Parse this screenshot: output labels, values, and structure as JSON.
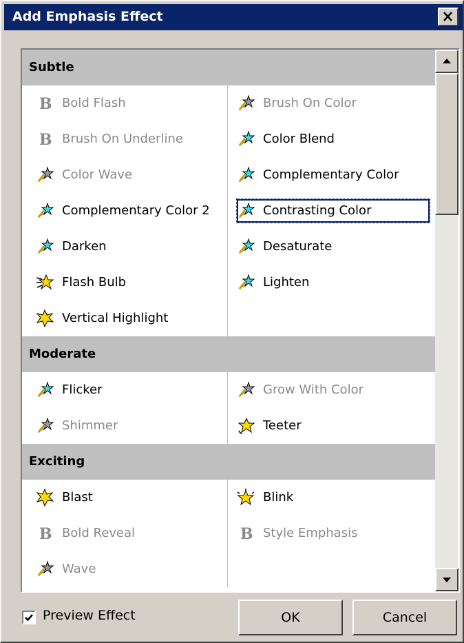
{
  "window": {
    "title": "Add Emphasis Effect"
  },
  "categories": [
    {
      "name": "Subtle",
      "items": [
        {
          "label": "Bold Flash",
          "icon": "bold-icon",
          "enabled": false,
          "col": 0,
          "row": 0
        },
        {
          "label": "Brush On Color",
          "icon": "star-effect-icon",
          "enabled": false,
          "col": 1,
          "row": 0
        },
        {
          "label": "Brush On Underline",
          "icon": "bold-icon",
          "enabled": false,
          "col": 0,
          "row": 1
        },
        {
          "label": "Color Blend",
          "icon": "star-effect-icon",
          "enabled": true,
          "col": 1,
          "row": 1
        },
        {
          "label": "Color Wave",
          "icon": "star-effect-icon",
          "enabled": false,
          "col": 0,
          "row": 2
        },
        {
          "label": "Complementary Color",
          "icon": "star-effect-icon",
          "enabled": true,
          "col": 1,
          "row": 2
        },
        {
          "label": "Complementary Color 2",
          "icon": "star-effect-icon",
          "enabled": true,
          "col": 0,
          "row": 3
        },
        {
          "label": "Contrasting Color",
          "icon": "star-effect-icon",
          "enabled": true,
          "col": 1,
          "row": 3,
          "focused": true
        },
        {
          "label": "Darken",
          "icon": "star-effect-icon",
          "enabled": true,
          "col": 0,
          "row": 4
        },
        {
          "label": "Desaturate",
          "icon": "star-effect-icon",
          "enabled": true,
          "col": 1,
          "row": 4
        },
        {
          "label": "Flash Bulb",
          "icon": "flash-bulb-icon",
          "enabled": true,
          "col": 0,
          "row": 5
        },
        {
          "label": "Lighten",
          "icon": "star-effect-icon",
          "enabled": true,
          "col": 1,
          "row": 5
        },
        {
          "label": "Vertical Highlight",
          "icon": "burst-star-icon",
          "enabled": true,
          "col": 0,
          "row": 6
        }
      ]
    },
    {
      "name": "Moderate",
      "items": [
        {
          "label": "Flicker",
          "icon": "star-effect-icon",
          "enabled": true,
          "col": 0,
          "row": 0
        },
        {
          "label": "Grow With Color",
          "icon": "star-effect-icon",
          "enabled": false,
          "col": 1,
          "row": 0
        },
        {
          "label": "Shimmer",
          "icon": "star-effect-icon",
          "enabled": false,
          "col": 0,
          "row": 1
        },
        {
          "label": "Teeter",
          "icon": "teeter-star-icon",
          "enabled": true,
          "col": 1,
          "row": 1
        }
      ]
    },
    {
      "name": "Exciting",
      "items": [
        {
          "label": "Blast",
          "icon": "burst-star-icon",
          "enabled": true,
          "col": 0,
          "row": 0
        },
        {
          "label": "Blink",
          "icon": "blink-star-icon",
          "enabled": true,
          "col": 1,
          "row": 0
        },
        {
          "label": "Bold Reveal",
          "icon": "bold-icon",
          "enabled": false,
          "col": 0,
          "row": 1
        },
        {
          "label": "Style Emphasis",
          "icon": "bold-icon",
          "enabled": false,
          "col": 1,
          "row": 1
        },
        {
          "label": "Wave",
          "icon": "star-effect-icon",
          "enabled": false,
          "col": 0,
          "row": 2
        }
      ]
    }
  ],
  "preview": {
    "label": "Preview Effect",
    "checked": true
  },
  "buttons": {
    "ok": "OK",
    "cancel": "Cancel"
  },
  "colors": {
    "titlebar": "#0a246a",
    "dialog": "#d4d0c8",
    "header": "#c0c0c0",
    "disabled": "#8a8a8a"
  }
}
